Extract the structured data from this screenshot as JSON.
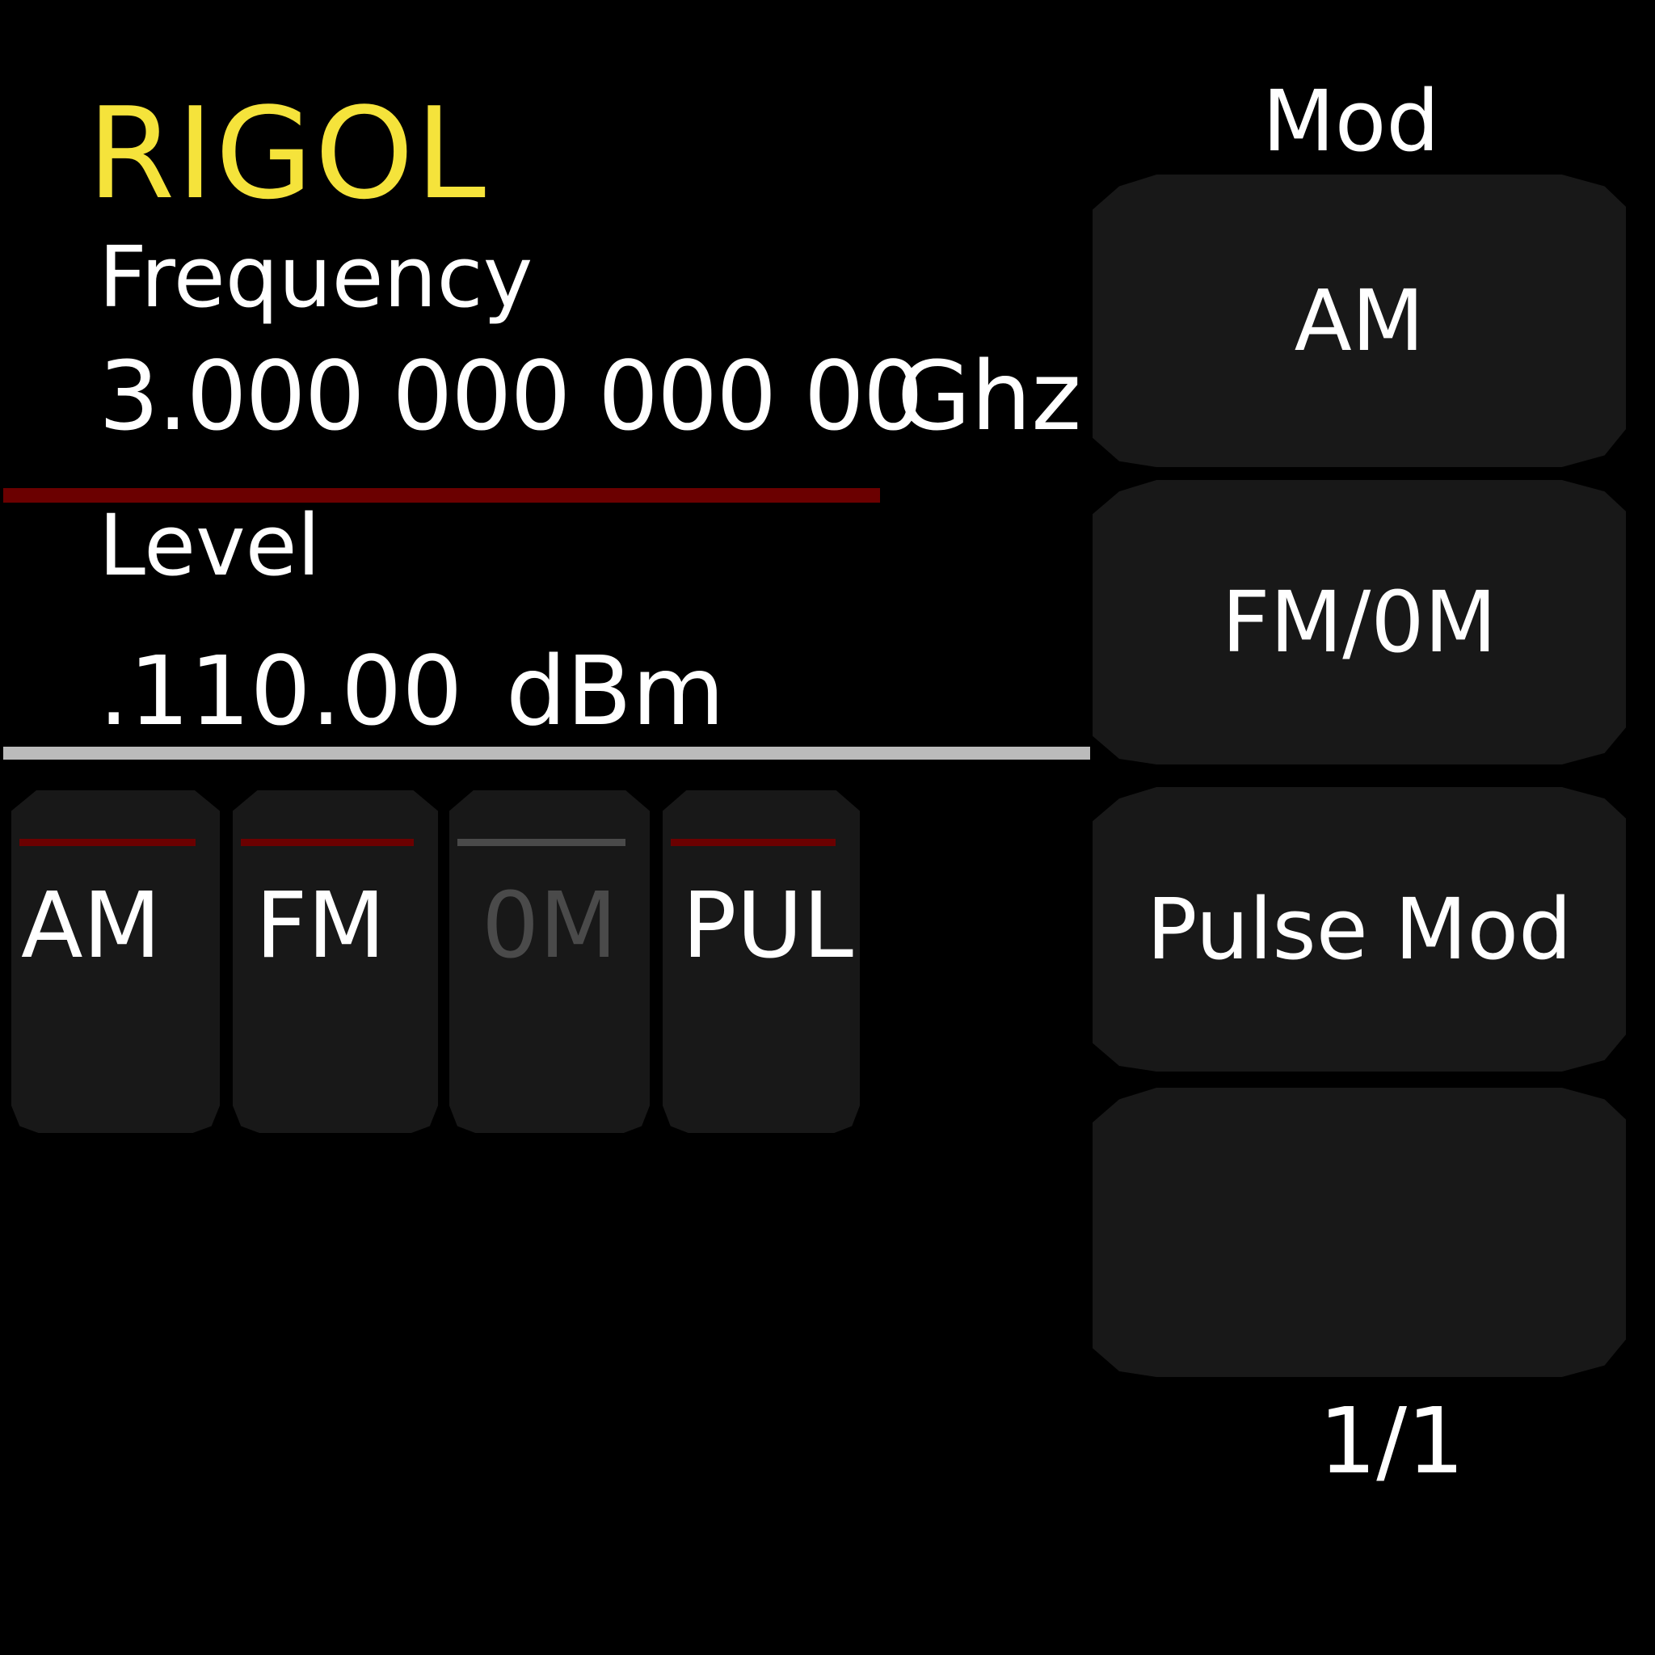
{
  "brand": {
    "logo_text": "RIGOL",
    "color": "#f5e33b"
  },
  "frequency": {
    "label": "Frequency",
    "value": "3.000 000 000 00",
    "unit": "Ghz",
    "indicator_color": "#6b0000"
  },
  "level": {
    "label": "Level",
    "value": ".110.00",
    "unit": "dBm",
    "divider_color": "#bbbbbb"
  },
  "status_keys": [
    {
      "label": "AM",
      "text_color": "#ffffff",
      "indicator_color": "#6b0000"
    },
    {
      "label": "FM",
      "text_color": "#ffffff",
      "indicator_color": "#6b0000"
    },
    {
      "label": "0M",
      "text_color": "#4a4a4a",
      "indicator_color": "#4a4a4a"
    },
    {
      "label": "PUL",
      "text_color": "#ffffff",
      "indicator_color": "#6b0000"
    }
  ],
  "menu": {
    "title": "Mod",
    "softkeys": [
      {
        "label": "AM"
      },
      {
        "label": "FM/0M"
      },
      {
        "label": "Pulse Mod"
      },
      {
        "label": ""
      }
    ],
    "page_indicator": "1/1"
  }
}
